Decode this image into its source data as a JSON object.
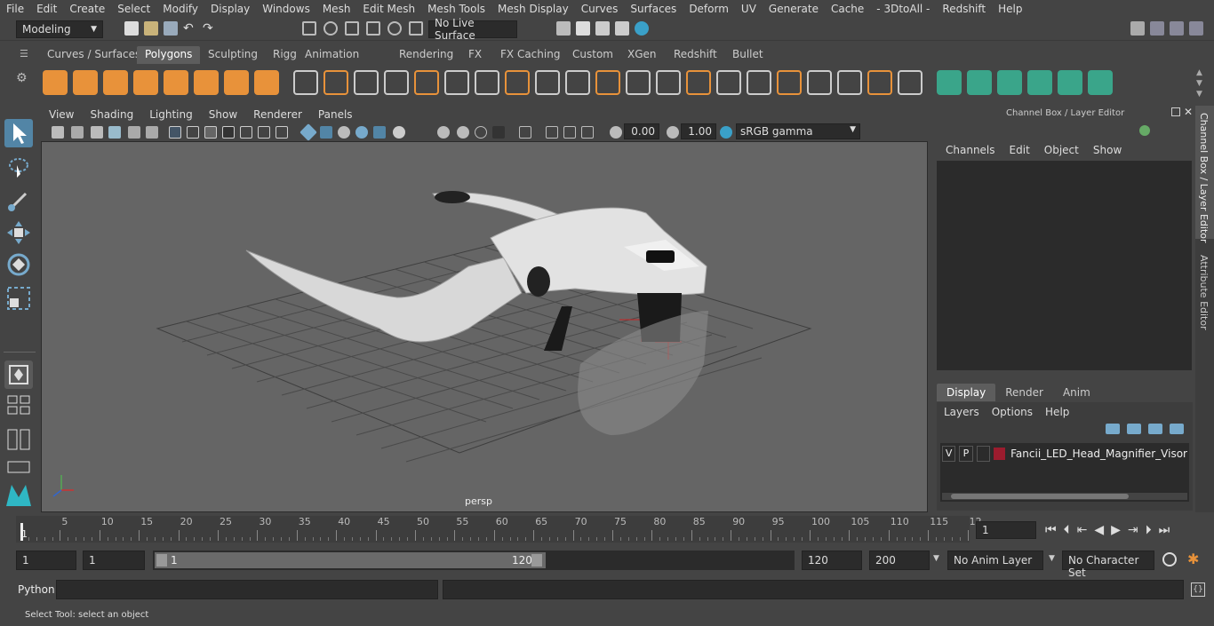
{
  "menubar": {
    "items": [
      "File",
      "Edit",
      "Create",
      "Select",
      "Modify",
      "Display",
      "Windows",
      "Mesh",
      "Edit Mesh",
      "Mesh Tools",
      "Mesh Display",
      "Curves",
      "Surfaces",
      "Deform",
      "UV",
      "Generate",
      "Cache",
      "- 3DtoAll -",
      "Redshift",
      "Help"
    ]
  },
  "statusline": {
    "mode": "Modeling",
    "live_surface": "No Live Surface"
  },
  "shelf": {
    "tabs": [
      "Curves / Surfaces",
      "Polygons",
      "Sculpting",
      "Rigging",
      "Animation",
      "Rendering",
      "FX",
      "FX Caching",
      "Custom",
      "XGen",
      "Redshift",
      "Bullet"
    ],
    "active_tab": "Polygons"
  },
  "viewport": {
    "menu": [
      "View",
      "Shading",
      "Lighting",
      "Show",
      "Renderer",
      "Panels"
    ],
    "exposure": "0.00",
    "gamma": "1.00",
    "color_space": "sRGB gamma",
    "camera_label": "persp"
  },
  "channelbox": {
    "title": "Channel Box / Layer Editor",
    "menu": [
      "Channels",
      "Edit",
      "Object",
      "Show"
    ],
    "layer_tabs": [
      "Display",
      "Render",
      "Anim"
    ],
    "active_layer_tab": "Display",
    "layer_menu": [
      "Layers",
      "Options",
      "Help"
    ],
    "layer": {
      "v": "V",
      "p": "P",
      "name": "Fancii_LED_Head_Magnifier_Visor",
      "color": "#9b1c2e"
    }
  },
  "right_tabs": [
    "Channel Box / Layer Editor",
    "Attribute Editor"
  ],
  "timeslider": {
    "ticks": [
      "5",
      "10",
      "15",
      "20",
      "25",
      "30",
      "35",
      "40",
      "45",
      "50",
      "55",
      "60",
      "65",
      "70",
      "75",
      "80",
      "85",
      "90",
      "95",
      "100",
      "105",
      "110",
      "115",
      "12"
    ],
    "current_frame_marker": "1",
    "current_frame": "1"
  },
  "range": {
    "start": "1",
    "playback_start": "1",
    "slider_start": "1",
    "slider_end": "120",
    "playback_end": "120",
    "end": "200",
    "anim_layer": "No Anim Layer",
    "character_set": "No Character Set"
  },
  "cmdline": {
    "label": "Python"
  },
  "helpline": {
    "text": "Select Tool: select an object"
  },
  "colors": {
    "accent": "#5285a6",
    "ui_bg": "#444444",
    "viewport_bg": "#656565",
    "shelf_icon_orange": "#e8923a",
    "shelf_icon_green": "#3aa58a"
  }
}
